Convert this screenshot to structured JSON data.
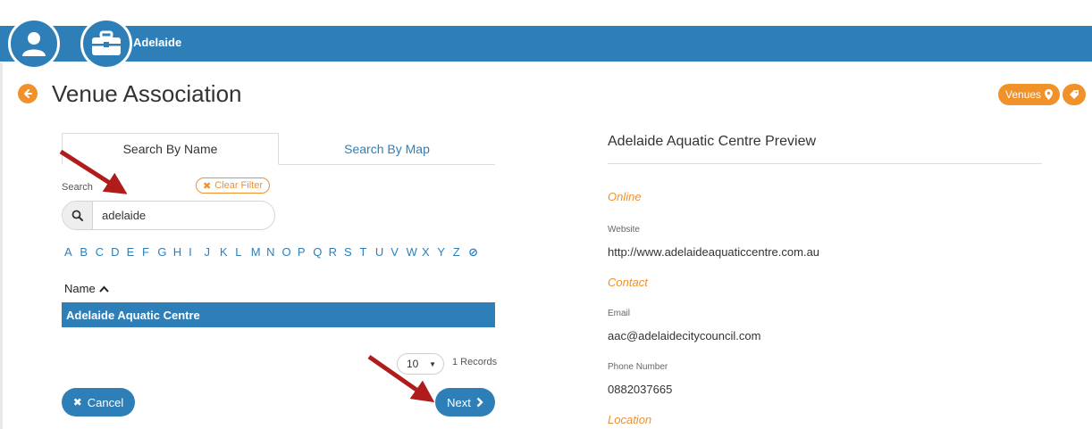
{
  "header": {
    "org_name": "Adelaide",
    "user_icon": "user-icon",
    "briefcase_icon": "briefcase-icon"
  },
  "page": {
    "title": "Venue Association",
    "back_icon": "arrow-left-icon",
    "venues_label": "Venues",
    "venues_icon": "map-marker-icon",
    "tag_icon": "tag-icon"
  },
  "tabs": [
    {
      "label": "Search By Name",
      "active": true
    },
    {
      "label": "Search By Map",
      "active": false
    }
  ],
  "search": {
    "label": "Search",
    "clear_filter": "Clear Filter",
    "value": "adelaide"
  },
  "alphabet": [
    "A",
    "B",
    "C",
    "D",
    "E",
    "F",
    "G",
    "H",
    "I",
    "J",
    "K",
    "L",
    "M",
    "N",
    "O",
    "P",
    "Q",
    "R",
    "S",
    "T",
    "U",
    "V",
    "W",
    "X",
    "Y",
    "Z"
  ],
  "table": {
    "column": "Name",
    "rows": [
      "Adelaide Aquatic Centre"
    ]
  },
  "pagination": {
    "page_size": "10",
    "records": "1 Records"
  },
  "actions": {
    "cancel": "Cancel",
    "next": "Next"
  },
  "preview": {
    "title": "Adelaide Aquatic Centre Preview",
    "online_heading": "Online",
    "website_label": "Website",
    "website_value": "http://www.adelaideaquaticcentre.com.au",
    "contact_heading": "Contact",
    "email_label": "Email",
    "email_value": "aac@adelaidecitycouncil.com",
    "phone_label": "Phone Number",
    "phone_value": "0882037665",
    "location_heading": "Location"
  },
  "colors": {
    "primary": "#2e7fb8",
    "accent": "#f0912a",
    "annotation_arrow": "#b01c1c"
  }
}
